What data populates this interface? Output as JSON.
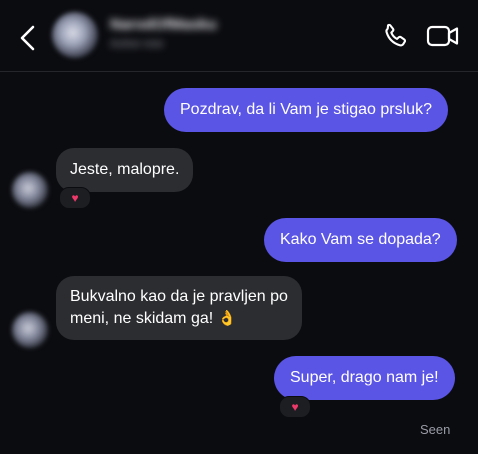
{
  "header": {
    "contact_name": "NarodOfMasku",
    "contact_status": "Active now"
  },
  "messages": [
    {
      "direction": "outgoing",
      "text": "Pozdrav, da li Vam je stigao prsluk?"
    },
    {
      "direction": "incoming",
      "text": "Jeste, malopre.",
      "reaction": "♥"
    },
    {
      "direction": "outgoing",
      "text": "Kako Vam se dopada?"
    },
    {
      "direction": "incoming",
      "lines": [
        "Bukvalno kao da je pravljen po",
        "meni, ne skidam ga!"
      ],
      "emoji": "👌"
    },
    {
      "direction": "outgoing",
      "text": "Super, drago nam je!",
      "reaction": "♥"
    }
  ],
  "seen_label": "Seen",
  "colors": {
    "background": "#0b0c10",
    "outgoing_bubble": "#5b55e6",
    "incoming_bubble": "#2b2d31",
    "reaction_heart": "#f0386b",
    "icon": "#ffffff"
  },
  "icons": {
    "back": "chevron-left-icon",
    "call": "phone-icon",
    "video": "video-camera-icon",
    "reaction": "heart-icon"
  }
}
